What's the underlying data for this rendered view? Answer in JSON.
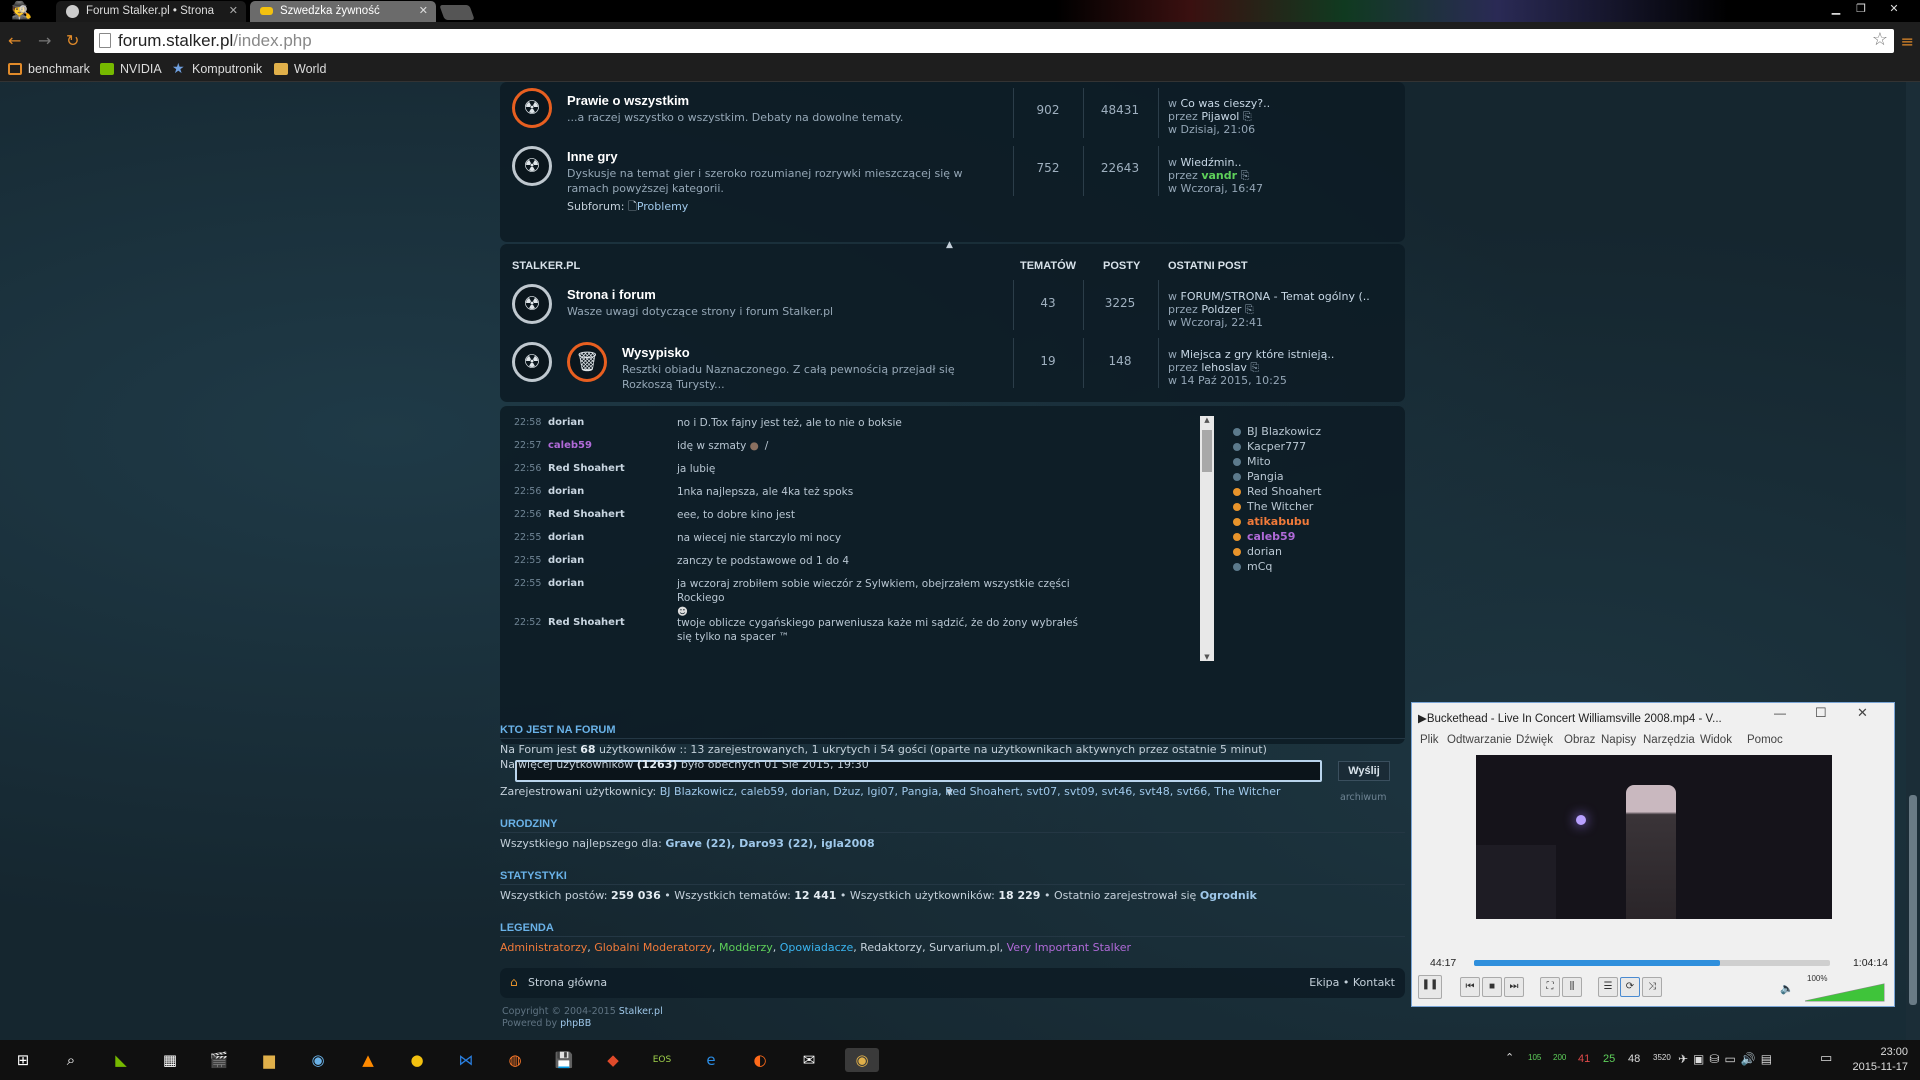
{
  "browser": {
    "tabs": [
      {
        "label": "Forum Stalker.pl • Strona",
        "active": true
      },
      {
        "label": "Szwedzka żywność",
        "active": false
      }
    ],
    "url_host": "forum.stalker.pl",
    "url_path": "/index.php",
    "bookmarks": [
      "benchmark",
      "NVIDIA",
      "Komputronik",
      "World"
    ]
  },
  "forums_top": [
    {
      "title": "Prawie o wszystkim",
      "desc": "...a raczej wszystko o wszystkim. Debaty na dowolne tematy.",
      "topics": "902",
      "posts": "48431",
      "last_topic": "Co was cieszy?..",
      "last_by": "Pijawol",
      "last_when": "Dzisiaj, 21:06"
    },
    {
      "title": "Inne gry",
      "desc": "Dyskusje na temat gier i szeroko rozumianej rozrywki mieszczącej się w ramach powyższej kategorii.",
      "topics": "752",
      "posts": "22643",
      "last_topic": "Wiedźmin..",
      "last_by": "vandr",
      "last_when": "Wczoraj, 16:47",
      "subforum_label": "Subforum:",
      "subforum": "Problemy"
    }
  ],
  "category": {
    "name": "STALKER.PL",
    "col_topics": "TEMATÓW",
    "col_posts": "POSTY",
    "col_last": "OSTATNI POST"
  },
  "forums_stalker": [
    {
      "title": "Strona i forum",
      "desc": "Wasze uwagi dotyczące strony i forum Stalker.pl",
      "topics": "43",
      "posts": "3225",
      "last_topic": "FORUM/STRONA - Temat ogólny (..",
      "last_by": "Poldzer",
      "last_when": "Wczoraj, 22:41"
    },
    {
      "title": "Wysypisko",
      "desc": "Resztki obiadu Naznaczonego. Z całą pewnością przejadł się Rozkoszą Turysty...",
      "topics": "19",
      "posts": "148",
      "last_topic": "Miejsca z gry które istnieją..",
      "last_by": "lehoslav",
      "last_when": "14 Paź 2015, 10:25"
    }
  ],
  "last_labels": {
    "in": "w",
    "by": "przez"
  },
  "chat": {
    "messages": [
      {
        "time": "22:58",
        "user": "dorian",
        "text": "no i D.Tox fajny jest też, ale to nie o boksie"
      },
      {
        "time": "22:57",
        "user": "caleb59",
        "text": "idę w szmaty",
        "tail": "/"
      },
      {
        "time": "22:56",
        "user": "Red Shoahert",
        "text": "ja lubię"
      },
      {
        "time": "22:56",
        "user": "dorian",
        "text": "1nka najlepsza, ale 4ka też spoks"
      },
      {
        "time": "22:56",
        "user": "Red Shoahert",
        "text": "eee, to dobre kino jest"
      },
      {
        "time": "22:55",
        "user": "dorian",
        "text": "na wiecej nie starczylo mi nocy"
      },
      {
        "time": "22:55",
        "user": "dorian",
        "text": "zanczy te podstawowe od 1 do 4"
      },
      {
        "time": "22:55",
        "user": "dorian",
        "text": "ja wczoraj zrobiłem sobie wieczór z Sylwkiem, obejrzałem wszystkie części Rockiego"
      },
      {
        "time": "22:52",
        "user": "Red Shoahert",
        "text": "twoje oblicze cygańskiego parweniusza każe mi sądzić, że do żony wybrałeś się tylko na spacer ™"
      }
    ],
    "online": [
      "BJ Blazkowicz",
      "Kacper777",
      "Mito",
      "Pangia",
      "Red Shoahert",
      "The Witcher",
      "atikabubu",
      "caleb59",
      "dorian",
      "mCq"
    ],
    "send_label": "Wyślij",
    "archive_label": "archiwum"
  },
  "who": {
    "title": "KTO JEST NA FORUM",
    "line1_a": "Na Forum jest ",
    "line1_count": "68",
    "line1_b": " użytkowników :: 13 zarejestrowanych, 1 ukrytych i 54 gości (oparte na użytkownikach aktywnych przez ostatnie 5 minut)",
    "line2_a": "Najwięcej użytkowników ",
    "line2_count": "(1263)",
    "line2_b": " było obecnych 01 Sie 2015, 19:30",
    "reg_label": "Zarejestrowani użytkownicy: ",
    "registered": "BJ Blazkowicz, caleb59, dorian, Dżuz, Igi07, Pangia, Red Shoahert, svt07, svt09, svt46, svt48, svt66, The Witcher"
  },
  "birthdays": {
    "title": "URODZINY",
    "label": "Wszystkiego najlepszego dla: ",
    "list": "Grave (22), Daro93 (22), igla2008"
  },
  "stats": {
    "title": "STATYSTYKI",
    "posts_label": "Wszystkich postów: ",
    "posts": "259 036",
    "topics_label": " • Wszystkich tematów: ",
    "topics": "12 441",
    "users_label": " • Wszystkich użytkowników: ",
    "users": "18 229",
    "newest_label": " • Ostatnio zarejestrował się ",
    "newest": "Ogrodnik"
  },
  "legend": {
    "title": "LEGENDA",
    "items": [
      {
        "label": "Administratorzy",
        "color": "#f07a3a"
      },
      {
        "label": "Globalni Moderatorzy",
        "color": "#f07a3a"
      },
      {
        "label": "Modderzy",
        "color": "#5ed05a"
      },
      {
        "label": "Opowiadacze",
        "color": "#3ab5f0"
      },
      {
        "label": "Redaktorzy",
        "color": "#c4d0da"
      },
      {
        "label": "Survarium.pl",
        "color": "#c4d0da"
      },
      {
        "label": "Very Important Stalker",
        "color": "#b06ad8"
      }
    ]
  },
  "footer": {
    "home": "Strona główna",
    "team": "Ekipa",
    "contact": "Kontakt",
    "copyright": "Copyright © 2004-2015 ",
    "copyright_site": "Stalker.pl",
    "powered": "Powered by ",
    "powered_link": "phpBB"
  },
  "vlc": {
    "title": "▶Buckethead - Live In Concert Williamsville 2008.mp4 - V...",
    "menu": [
      "Plik",
      "Odtwarzanie",
      "Dźwięk",
      "Obraz",
      "Napisy",
      "Narzędzia",
      "Widok",
      "Pomoc"
    ],
    "elapsed": "44:17",
    "total": "1:04:14",
    "progress": 0.69,
    "volume": "100%"
  },
  "taskbar": {
    "time": "23:00",
    "date": "2015-11-17",
    "tray_nums": [
      "105",
      "200",
      "41",
      "25",
      "48",
      "3520"
    ]
  },
  "colors": {
    "accent": "#e8942b",
    "vip": "#b06ad8",
    "link": "#9fc8ea"
  }
}
